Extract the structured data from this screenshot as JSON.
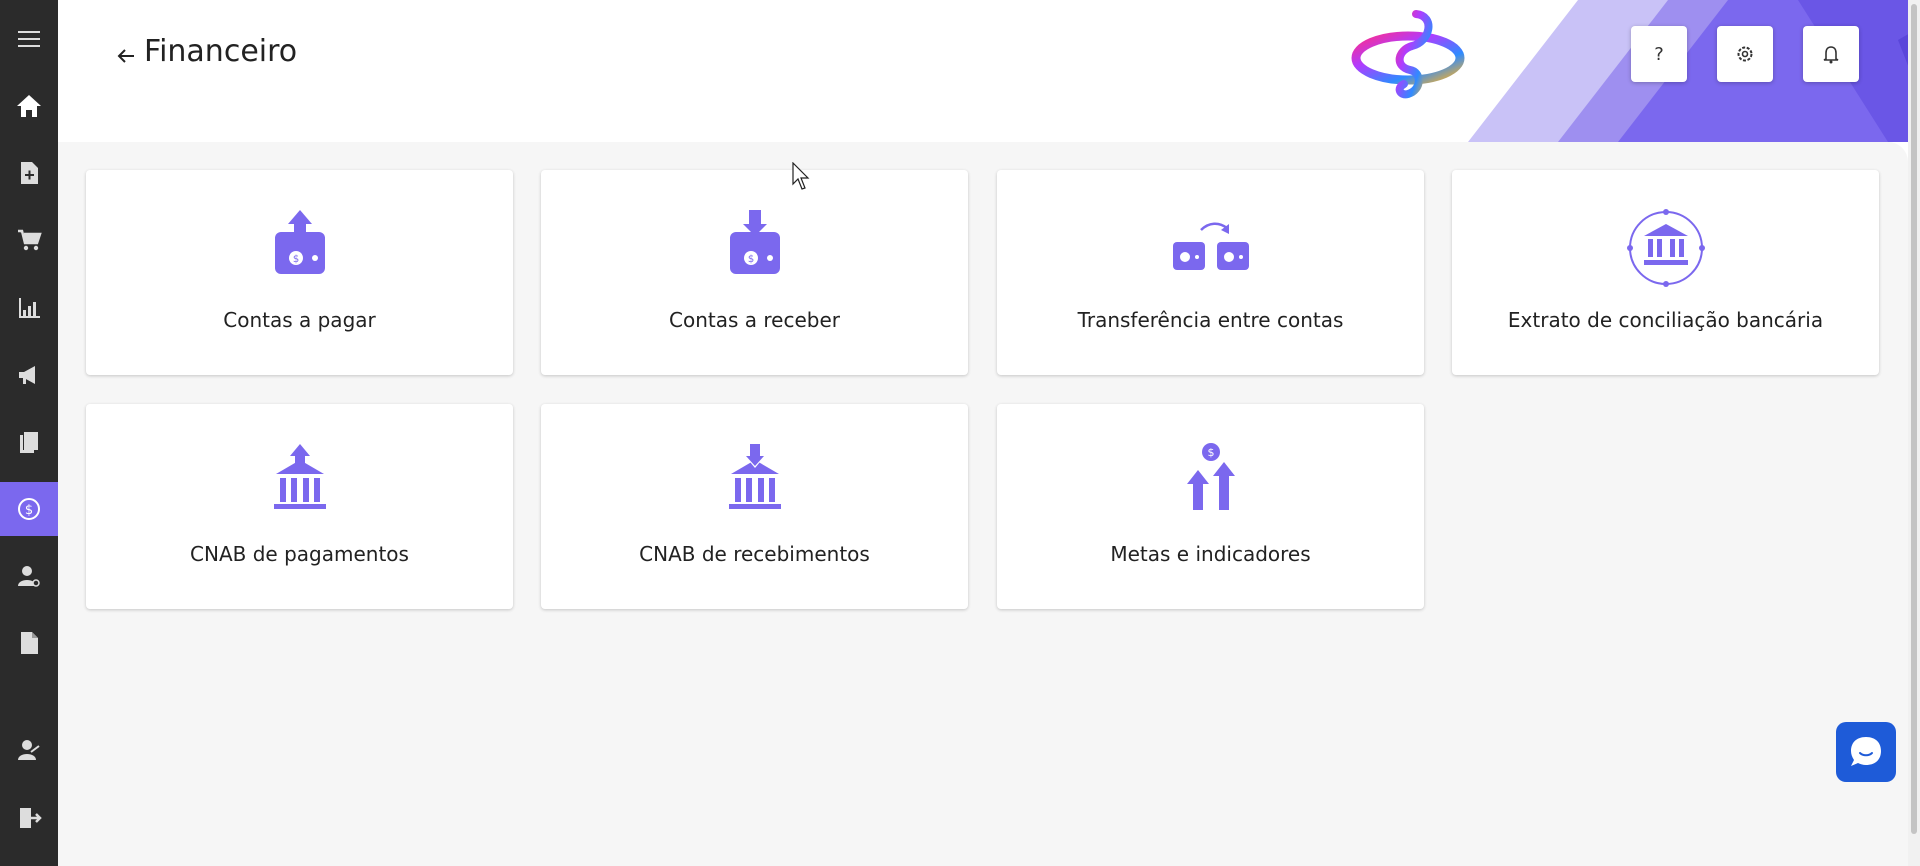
{
  "header": {
    "title": "Financeiro",
    "back_icon": "arrow-left-icon",
    "help_icon": "question-icon",
    "settings_icon": "gear-icon",
    "notifications_icon": "bell-icon"
  },
  "sidebar": {
    "items": [
      {
        "name": "menu",
        "icon": "hamburger-icon"
      },
      {
        "name": "home",
        "icon": "home-icon"
      },
      {
        "name": "documents",
        "icon": "file-plus-icon"
      },
      {
        "name": "sales",
        "icon": "cart-icon"
      },
      {
        "name": "reports",
        "icon": "chart-icon"
      },
      {
        "name": "marketing",
        "icon": "megaphone-icon"
      },
      {
        "name": "catalog",
        "icon": "files-icon"
      },
      {
        "name": "financial",
        "icon": "dollar-icon",
        "active": true
      },
      {
        "name": "users",
        "icon": "user-gear-icon"
      },
      {
        "name": "fiscal",
        "icon": "file-icon"
      },
      {
        "name": "support",
        "icon": "user-support-icon"
      },
      {
        "name": "logout",
        "icon": "logout-icon"
      }
    ]
  },
  "cards": [
    {
      "label": "Contas a pagar",
      "icon": "wallet-up-icon"
    },
    {
      "label": "Contas a receber",
      "icon": "wallet-down-icon"
    },
    {
      "label": "Transferência entre contas",
      "icon": "transfer-icon"
    },
    {
      "label": "Extrato de conciliação bancária",
      "icon": "bank-circle-icon"
    },
    {
      "label": "CNAB de pagamentos",
      "icon": "bank-up-icon"
    },
    {
      "label": "CNAB de recebimentos",
      "icon": "bank-down-icon"
    },
    {
      "label": "Metas e indicadores",
      "icon": "goals-icon"
    }
  ],
  "colors": {
    "accent": "#7b68ee",
    "sidebar_bg": "#2b2b2b",
    "content_bg": "#f6f6f6",
    "chat_blue": "#1e5bd8"
  }
}
